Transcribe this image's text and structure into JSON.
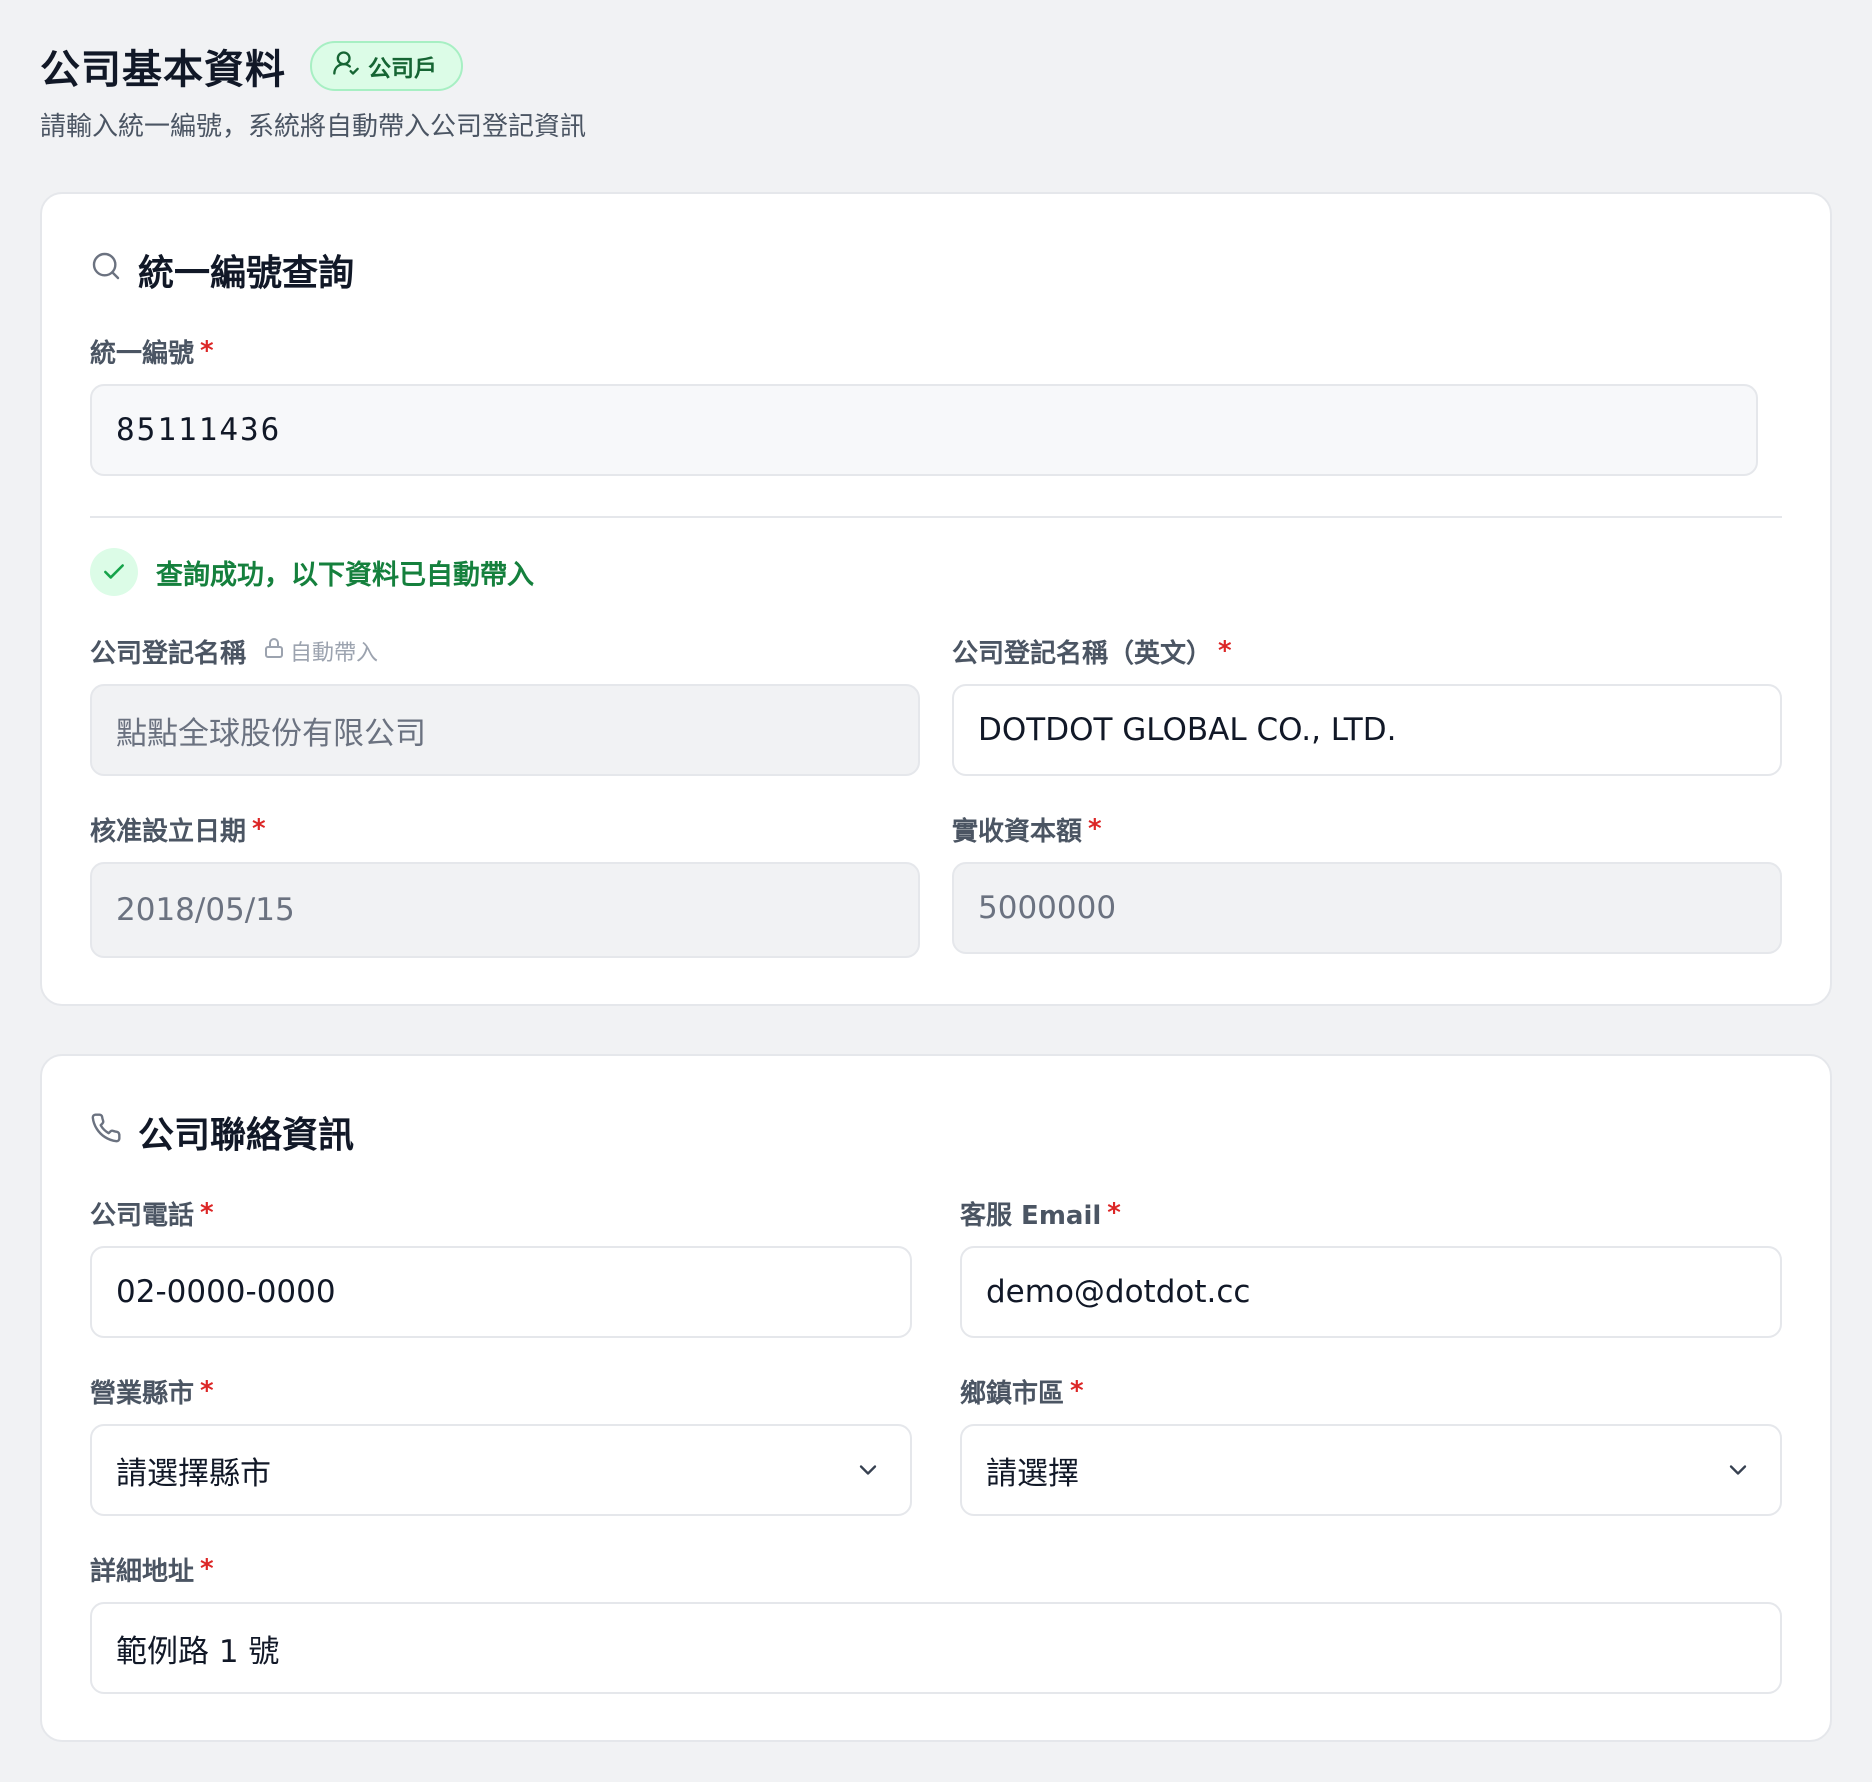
{
  "header": {
    "title": "公司基本資料",
    "badge": "公司戶",
    "subtitle": "請輸入統一編號，系統將自動帶入公司登記資訊"
  },
  "lookup": {
    "section_title": "統一編號查詢",
    "tax_id_label": "統一編號",
    "tax_id_value": "85111436",
    "success_message": "查詢成功，以下資料已自動帶入",
    "company_name_label": "公司登記名稱",
    "auto_fill_tag": "自動帶入",
    "company_name_value": "點點全球股份有限公司",
    "company_name_en_label": "公司登記名稱（英文）",
    "company_name_en_value": "DOTDOT GLOBAL CO., LTD.",
    "founded_label": "核准設立日期",
    "founded_value": "2018/05/15",
    "capital_label": "實收資本額",
    "capital_value": "5000000"
  },
  "contact": {
    "section_title": "公司聯絡資訊",
    "phone_label": "公司電話",
    "phone_value": "02-0000-0000",
    "email_label": "客服 Email",
    "email_value": "demo@dotdot.cc",
    "city_label": "營業縣市",
    "city_value": "請選擇縣市",
    "district_label": "鄉鎮市區",
    "district_value": "請選擇",
    "address_label": "詳細地址",
    "address_value": "範例路 1 號"
  },
  "required_mark": "*",
  "icons": {
    "badge": "user-check-icon",
    "lookup": "search-icon",
    "success": "check-icon",
    "lock": "lock-icon",
    "contact": "phone-icon",
    "select": "chevron-down-icon"
  },
  "colors": {
    "required": "#dc2626",
    "success": "#15803d",
    "badge_bg": "#dcfce7"
  }
}
